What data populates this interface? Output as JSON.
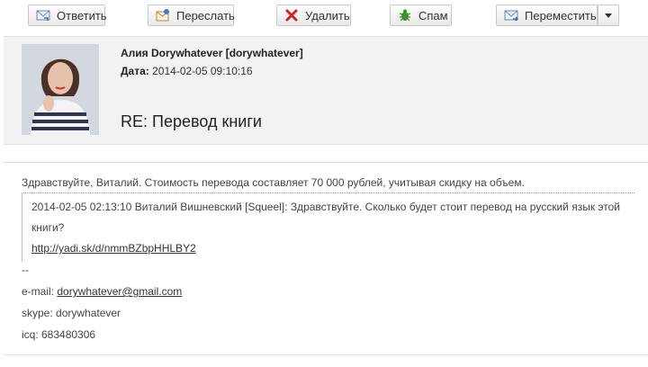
{
  "toolbar": {
    "reply_label": "Ответить",
    "forward_label": "Переслать",
    "delete_label": "Удалить",
    "spam_label": "Спам",
    "move_label": "Переместить"
  },
  "message": {
    "sender": "Алия Dorywhatever [dorywhatever]",
    "date_label": "Дата:",
    "date_value": "2014-02-05 09:10:16",
    "subject": "RE: Перевод книги"
  },
  "body": {
    "greeting": "Здравствуйте, Виталий. Стоимость перевода составляет 70 000 рублей, учитывая скидку на объем.",
    "quote_line1": "2014-02-05 02:13:10 Виталий Вишневский [Squeel]: Здравствуйте. Сколько будет стоит перевод на русский язык этой",
    "quote_line2": "книги?",
    "quote_link": "http://yadi.sk/d/nmmBZbpHHLBY2",
    "sig_dash": "--",
    "email_label": "e-mail:",
    "email_value": "dorywhatever@gmail.com",
    "skype": "skype: dorywhatever",
    "icq": "icq: 683480306"
  },
  "colors": {
    "header_bg": "#f2f2f2",
    "delete_red": "#cc2222",
    "spam_green": "#3f8f2f"
  }
}
